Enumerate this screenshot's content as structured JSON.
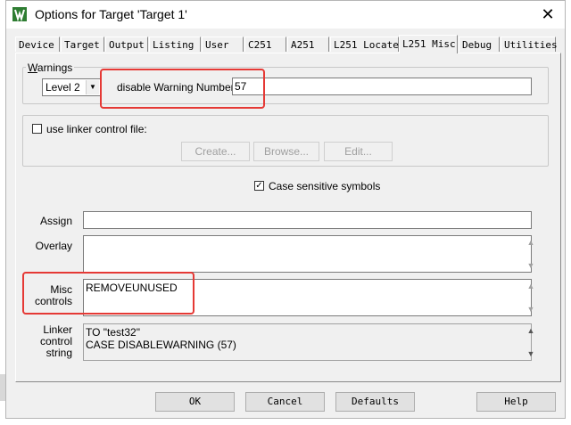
{
  "window": {
    "title": "Options for Target 'Target 1'",
    "close_glyph": "✕",
    "app_icon": "keil-uvision-icon"
  },
  "tabs": [
    {
      "label": "Device"
    },
    {
      "label": "Target"
    },
    {
      "label": "Output"
    },
    {
      "label": "Listing"
    },
    {
      "label": "User"
    },
    {
      "label": "C251"
    },
    {
      "label": "A251"
    },
    {
      "label": "L251 Locate"
    },
    {
      "label": "L251 Misc"
    },
    {
      "label": "Debug"
    },
    {
      "label": "Utilities"
    }
  ],
  "active_tab": "L251 Misc",
  "warnings": {
    "group_title": "Warnings",
    "level_value": "Level 2",
    "disable_label": "disable Warning Numbers:",
    "disable_value": "57"
  },
  "linker_control": {
    "checkbox_label": "use linker control file:",
    "checked": false,
    "create_label": "Create...",
    "browse_label": "Browse...",
    "edit_label": "Edit..."
  },
  "case_sensitive": {
    "label": "Case sensitive symbols",
    "checked": true
  },
  "assign": {
    "label": "Assign",
    "value": ""
  },
  "overlay": {
    "label": "Overlay",
    "value": ""
  },
  "misc_controls": {
    "label_line1": "Misc",
    "label_line2": "controls",
    "value": "REMOVEUNUSED"
  },
  "linker_string": {
    "label_line1": "Linker",
    "label_line2": "control",
    "label_line3": "string",
    "line1": "TO \"test32\"",
    "line2": "CASE DISABLEWARNING (57)"
  },
  "footer": {
    "ok_label": "OK",
    "cancel_label": "Cancel",
    "defaults_label": "Defaults",
    "help_label": "Help"
  },
  "colors": {
    "highlight_box": "#e53935",
    "dialog_bg": "#f0f0f0"
  }
}
